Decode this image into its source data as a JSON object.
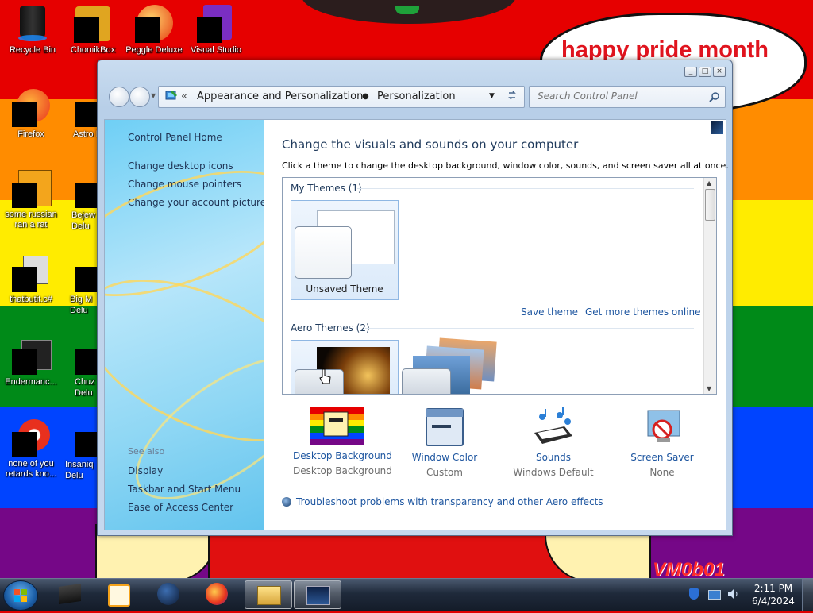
{
  "wallpaper": {
    "bubble_text": "happy pride month",
    "signature": "VM0b01"
  },
  "desktop_icons": [
    {
      "label": "Recycle Bin"
    },
    {
      "label": "ChomikBox"
    },
    {
      "label": "Peggle Deluxe"
    },
    {
      "label": "Visual Studio"
    },
    {
      "label": "Firefox"
    },
    {
      "label": "Astro Delu"
    },
    {
      "label": "some russian ran a rat"
    },
    {
      "label": "Bejew Delu"
    },
    {
      "label": "thatbutit.c#"
    },
    {
      "label": "Big M Delu"
    },
    {
      "label": "Endermanc..."
    },
    {
      "label": "Chuz Delu"
    },
    {
      "label": "none of you retards kno..."
    },
    {
      "label": "Insaniq Delu"
    }
  ],
  "window": {
    "breadcrumb": [
      "Appearance and Personalization",
      "Personalization"
    ],
    "search_placeholder": "Search Control Panel",
    "sidebar": {
      "links": [
        "Control Panel Home",
        "Change desktop icons",
        "Change mouse pointers",
        "Change your account picture"
      ],
      "see_also_label": "See also",
      "see_also": [
        "Display",
        "Taskbar and Start Menu",
        "Ease of Access Center"
      ]
    },
    "main": {
      "title": "Change the visuals and sounds on your computer",
      "description": "Click a theme to change the desktop background, window color, sounds, and screen saver all at once.",
      "my_themes_header": "My Themes (1)",
      "unsaved_theme_label": "Unsaved Theme",
      "save_theme": "Save theme",
      "get_more_themes": "Get more themes online",
      "aero_themes_header": "Aero Themes (2)"
    },
    "bottom_items": [
      {
        "title": "Desktop Background",
        "subtitle": "Desktop Background"
      },
      {
        "title": "Window Color",
        "subtitle": "Custom"
      },
      {
        "title": "Sounds",
        "subtitle": "Windows Default"
      },
      {
        "title": "Screen Saver",
        "subtitle": "None"
      }
    ],
    "troubleshoot_link": "Troubleshoot problems with transparency and other Aero effects"
  },
  "taskbar": {
    "time": "2:11 PM",
    "date": "6/4/2024"
  },
  "colors": {
    "link": "#1e56a0",
    "title_blue": "#1e395b"
  }
}
